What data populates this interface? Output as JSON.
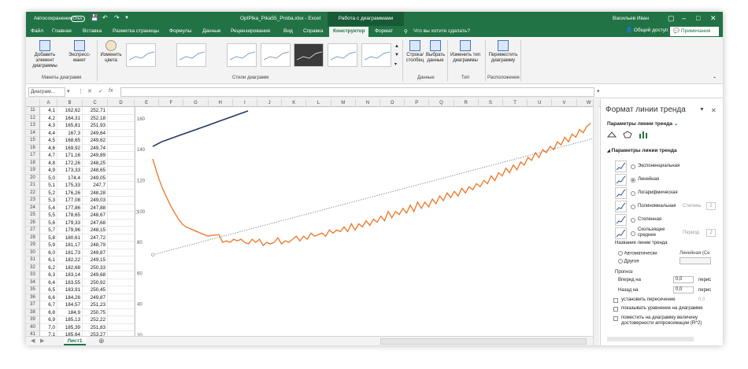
{
  "titlebar": {
    "autosave": "Автосохранение",
    "autosave_state": "Откл.",
    "filename": "OptPika_Pika55_Proba.xlsx - Excel",
    "context_tab": "Работа с диаграммами",
    "user": "Васильев Иван"
  },
  "tabs": [
    "Файл",
    "Главная",
    "Вставка",
    "Разметка страницы",
    "Формулы",
    "Данные",
    "Рецензирование",
    "Вид",
    "Справка",
    "Конструктор",
    "Формат"
  ],
  "active_tab": "Конструктор",
  "search": "Что вы хотите сделать?",
  "share": "Общий доступ",
  "comments": "Примечания",
  "ribbon": {
    "add_element": "Добавить элемент диаграммы",
    "express_layout": "Экспресс-макет",
    "group_layouts": "Макеты диаграмм",
    "change_colors": "Изменить цвета",
    "group_styles": "Стили диаграмм",
    "row_col": "Строка/столбец",
    "select_data": "Выбрать данные",
    "group_data": "Данные",
    "change_type": "Изменить тип диаграммы",
    "group_type": "Тип",
    "move_chart": "Переместить диаграмму",
    "group_location": "Расположение"
  },
  "namebox": "Диаграм...",
  "fx": "fx",
  "columns": [
    "A",
    "B",
    "C",
    "D",
    "E",
    "F",
    "G",
    "H",
    "I",
    "J",
    "K",
    "L",
    "M",
    "N",
    "O",
    "P",
    "Q",
    "R",
    "S",
    "T",
    "U",
    "V",
    "W"
  ],
  "rows": [
    {
      "n": "11",
      "a": "4,1",
      "b": "162,62",
      "c": "252,71"
    },
    {
      "n": "12",
      "a": "4,2",
      "b": "164,31",
      "c": "252,18"
    },
    {
      "n": "13",
      "a": "4,3",
      "b": "165,81",
      "c": "251,93"
    },
    {
      "n": "14",
      "a": "4,4",
      "b": "167,3",
      "c": "249,64"
    },
    {
      "n": "15",
      "a": "4,5",
      "b": "168,65",
      "c": "249,62"
    },
    {
      "n": "16",
      "a": "4,6",
      "b": "169,92",
      "c": "249,74"
    },
    {
      "n": "17",
      "a": "4,7",
      "b": "171,16",
      "c": "249,89"
    },
    {
      "n": "18",
      "a": "4,8",
      "b": "172,26",
      "c": "248,25"
    },
    {
      "n": "19",
      "a": "4,9",
      "b": "173,33",
      "c": "248,65"
    },
    {
      "n": "20",
      "a": "5,0",
      "b": "174,4",
      "c": "249,05"
    },
    {
      "n": "21",
      "a": "5,1",
      "b": "175,33",
      "c": "247,7"
    },
    {
      "n": "22",
      "a": "5,2",
      "b": "176,26",
      "c": "248,28"
    },
    {
      "n": "23",
      "a": "5,3",
      "b": "177,08",
      "c": "249,03"
    },
    {
      "n": "24",
      "a": "5,4",
      "b": "177,86",
      "c": "247,88"
    },
    {
      "n": "25",
      "a": "5,5",
      "b": "178,65",
      "c": "248,67"
    },
    {
      "n": "26",
      "a": "5,6",
      "b": "179,33",
      "c": "247,68"
    },
    {
      "n": "27",
      "a": "5,7",
      "b": "179,96",
      "c": "248,15"
    },
    {
      "n": "28",
      "a": "5,8",
      "b": "180,61",
      "c": "247,72"
    },
    {
      "n": "29",
      "a": "5,9",
      "b": "181,17",
      "c": "248,79"
    },
    {
      "n": "30",
      "a": "6,0",
      "b": "181,73",
      "c": "249,87"
    },
    {
      "n": "31",
      "a": "6,1",
      "b": "182,22",
      "c": "249,15"
    },
    {
      "n": "32",
      "a": "6,2",
      "b": "182,68",
      "c": "250,33"
    },
    {
      "n": "33",
      "a": "6,3",
      "b": "183,14",
      "c": "249,68"
    },
    {
      "n": "34",
      "a": "6,4",
      "b": "183,55",
      "c": "250,92"
    },
    {
      "n": "35",
      "a": "6,5",
      "b": "183,91",
      "c": "250,45"
    },
    {
      "n": "36",
      "a": "6,6",
      "b": "184,26",
      "c": "249,87"
    },
    {
      "n": "37",
      "a": "6,7",
      "b": "184,57",
      "c": "251,23"
    },
    {
      "n": "38",
      "a": "6,8",
      "b": "184,9",
      "c": "250,75"
    },
    {
      "n": "39",
      "a": "6,9",
      "b": "185,13",
      "c": "252,22"
    },
    {
      "n": "40",
      "a": "7,0",
      "b": "185,39",
      "c": "251,83"
    },
    {
      "n": "41",
      "a": "7,1",
      "b": "185,64",
      "c": "253,27"
    }
  ],
  "sheet_tab": "Лист1",
  "chart_data": {
    "type": "line",
    "yticks": [
      "160",
      "140",
      "120",
      "100",
      "80",
      "60",
      "40",
      "20"
    ],
    "ylim": [
      20,
      165
    ],
    "series": [
      {
        "color": "#203864",
        "values": [
          142,
          145,
          147,
          149,
          151,
          153,
          155,
          157,
          159,
          161,
          163,
          165
        ]
      },
      {
        "color": "#ed7d31",
        "values": [
          134,
          126,
          119,
          113,
          108,
          103,
          99,
          95,
          92,
          90,
          89,
          88,
          87,
          86,
          85,
          84,
          84.5,
          84.7,
          85,
          80,
          81,
          80,
          82,
          81,
          82,
          80,
          79,
          82,
          80,
          82,
          78,
          80,
          79,
          80,
          83,
          79,
          81,
          80,
          82,
          84,
          81,
          84,
          82,
          86,
          84,
          85,
          86,
          84,
          88,
          86,
          88,
          87,
          90,
          87,
          92,
          88,
          92,
          90,
          94,
          91,
          95,
          93,
          97,
          94,
          100,
          96,
          100,
          98,
          102,
          99,
          104,
          100,
          106,
          102,
          106,
          103,
          108,
          105,
          110,
          107,
          112,
          109,
          113,
          110,
          115,
          112,
          116,
          114,
          118,
          116,
          120,
          118,
          123,
          120,
          125,
          123,
          128,
          125,
          130,
          127,
          132,
          130,
          135,
          133,
          138,
          135,
          140,
          138,
          142,
          140,
          145,
          143,
          148,
          145,
          150,
          148,
          153,
          151,
          155,
          157
        ]
      },
      {
        "color": "#7f7f7f",
        "dashed": true,
        "values": [
          72,
          147
        ]
      }
    ]
  },
  "pane": {
    "title": "Формат линии тренда",
    "subtitle": "Параметры линии тренда",
    "section": "Параметры линии тренда",
    "options": [
      {
        "label": "Экспоненциальная",
        "on": false
      },
      {
        "label": "Линейная",
        "on": true
      },
      {
        "label": "Логарифмическая",
        "on": false
      },
      {
        "label": "Полиномиальная",
        "on": false,
        "sub": "Степень",
        "val": "2"
      },
      {
        "label": "Степенная",
        "on": false
      },
      {
        "label": "Скользящее среднее",
        "on": false,
        "sub": "Период",
        "val": "2"
      }
    ],
    "name_section": "Название линии тренда",
    "auto": "Автоматически",
    "auto_value": "Линейная (Се",
    "other": "Другое",
    "forecast": "Прогноз",
    "forward": "Вперед на",
    "forward_val": "0,0",
    "backward": "Назад на",
    "backward_val": "0,0",
    "periods": "перис",
    "set_intercept": "установить пересечение",
    "intercept_val": "0,0",
    "show_eq": "показывать уравнение на диаграмме",
    "show_r2": "поместить на диаграмму величину достоверности аппроксимации (R^2)"
  },
  "colors": {
    "excel_green": "#217346",
    "dark_green": "#185a36",
    "accent_blue": "#2f5597",
    "orange": "#ed7d31"
  }
}
